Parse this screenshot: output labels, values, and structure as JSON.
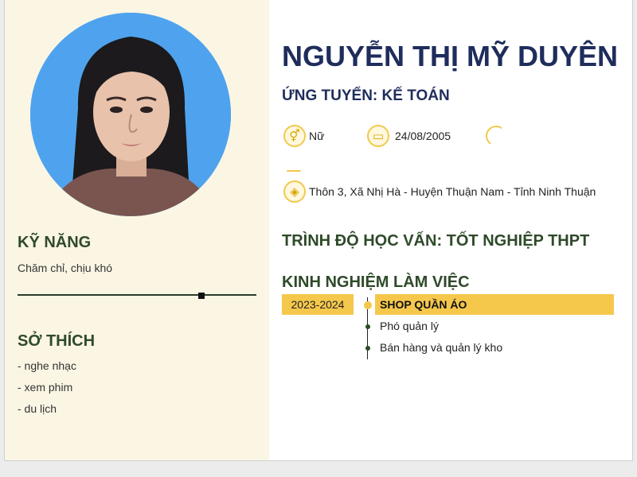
{
  "profile": {
    "name": "NGUYỄN THỊ MỸ DUYÊN",
    "position": "ỨNG TUYỂN: KẾ TOÁN",
    "gender": "Nữ",
    "birthday": "24/08/2005",
    "address": "Thôn 3, Xã Nhị Hà - Huyện Thuận Nam - Tỉnh Ninh Thuận"
  },
  "skills": {
    "title": "KỸ NĂNG",
    "text": "Chăm chỉ, chịu khó",
    "level": 0.77
  },
  "hobbies": {
    "title": "SỞ THÍCH",
    "items": [
      "- nghe nhạc",
      "- xem phim",
      "- du lịch"
    ]
  },
  "education": {
    "title": "TRÌNH ĐỘ HỌC VẤN: TỐT NGHIỆP THPT"
  },
  "experience": {
    "title": "KINH NGHIỆM LÀM VIỆC",
    "period": "2023-2024",
    "company": "SHOP QUẦN ÁO",
    "details": [
      "Phó quản lý",
      "Bán hàng và quản lý kho"
    ]
  },
  "icons": {
    "gender": "gender-icon",
    "birthday": "cake-icon",
    "address": "map-icon"
  },
  "colors": {
    "accent": "#f5c84c",
    "name": "#1f2d5c",
    "section": "#2f4a2a",
    "sidebar": "#fbf6e4",
    "photo_bg": "#4fa3ee"
  }
}
